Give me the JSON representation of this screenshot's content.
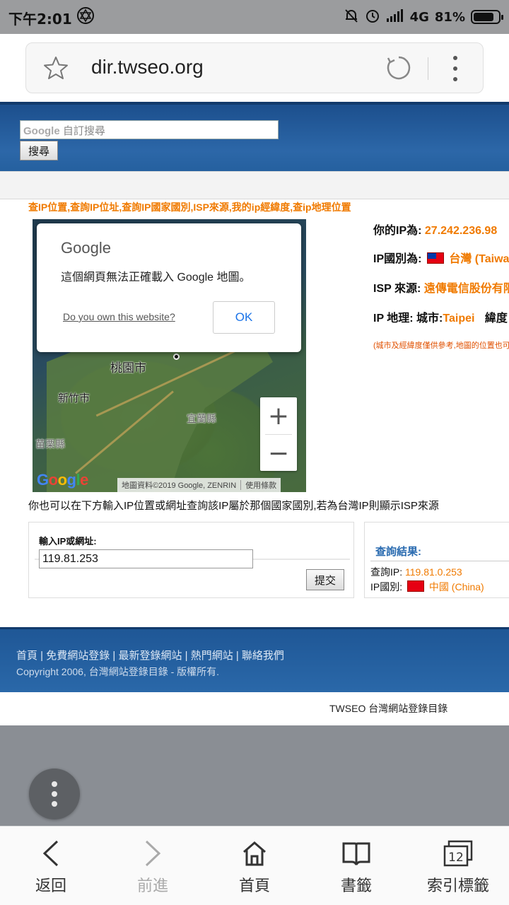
{
  "status_bar": {
    "time": "下午2:01",
    "network": "4G",
    "battery": "81%",
    "battery_level": 0.81
  },
  "browser": {
    "url": "dir.twseo.org"
  },
  "page": {
    "search": {
      "placeholder_brand": "Google",
      "placeholder": "自訂搜尋",
      "button": "搜尋"
    },
    "headline": "查IP位置,查詢IP位址,查詢IP國家國別,ISP來源,我的ip經緯度,查ip地理位置",
    "map": {
      "labels": {
        "taoyuan": "桃園市",
        "hsinchu": "新竹市",
        "yilan": "宜蘭縣",
        "miaoli": "苗栗縣"
      },
      "logo": "Google",
      "attribution": "地圖資料©2019 Google, ZENRIN",
      "terms": "使用條款",
      "zoom_in": "+",
      "zoom_out": "−",
      "dialog": {
        "brand": "Google",
        "message": "這個網頁無法正確載入 Google 地圖。",
        "link": "Do you own this website?",
        "ok": "OK"
      }
    },
    "ip_info": {
      "ip_label": "你的IP為:",
      "ip_value": "27.242.236.98",
      "country_label": "IP國別為:",
      "country_value": "台灣 (Taiwan)",
      "isp_label": "ISP 來源:",
      "isp_value": "遠傳電信股份有限公司",
      "geo_label": "IP 地理: 城市:",
      "geo_city": "Taipei",
      "geo_lat": "緯度",
      "note": "(城市及經緯度僅供參考,地圖的位置也可能有誤差)"
    },
    "input_hint": "你也可以在下方輸入IP位置或網址查詢該IP屬於那個國家國別,若為台灣IP則顯示ISP來源",
    "query_form": {
      "label": "輸入IP或網址:",
      "value": "119.81.253",
      "submit": "提交"
    },
    "result": {
      "title": "查詢結果:",
      "ip_label": "查詢IP:",
      "ip_value": "119.81.0.253",
      "country_label": "IP國別:",
      "country_value": "中國 (China)"
    },
    "footer": {
      "links": "首頁 | 免費網站登錄 | 最新登錄網站 | 熱門網站 | 聯絡我們",
      "copyright": "Copyright 2006, 台灣網站登錄目錄 - 版權所有."
    },
    "brand": "TWSEO 台灣網站登錄目錄"
  },
  "bottom_nav": [
    {
      "label": "返回",
      "icon": "back-arrow-icon"
    },
    {
      "label": "前進",
      "icon": "forward-arrow-icon"
    },
    {
      "label": "首頁",
      "icon": "home-icon"
    },
    {
      "label": "書籤",
      "icon": "bookmark-book-icon"
    },
    {
      "label": "索引標籤",
      "icon": "tabs-icon",
      "tab_count": "12"
    }
  ]
}
